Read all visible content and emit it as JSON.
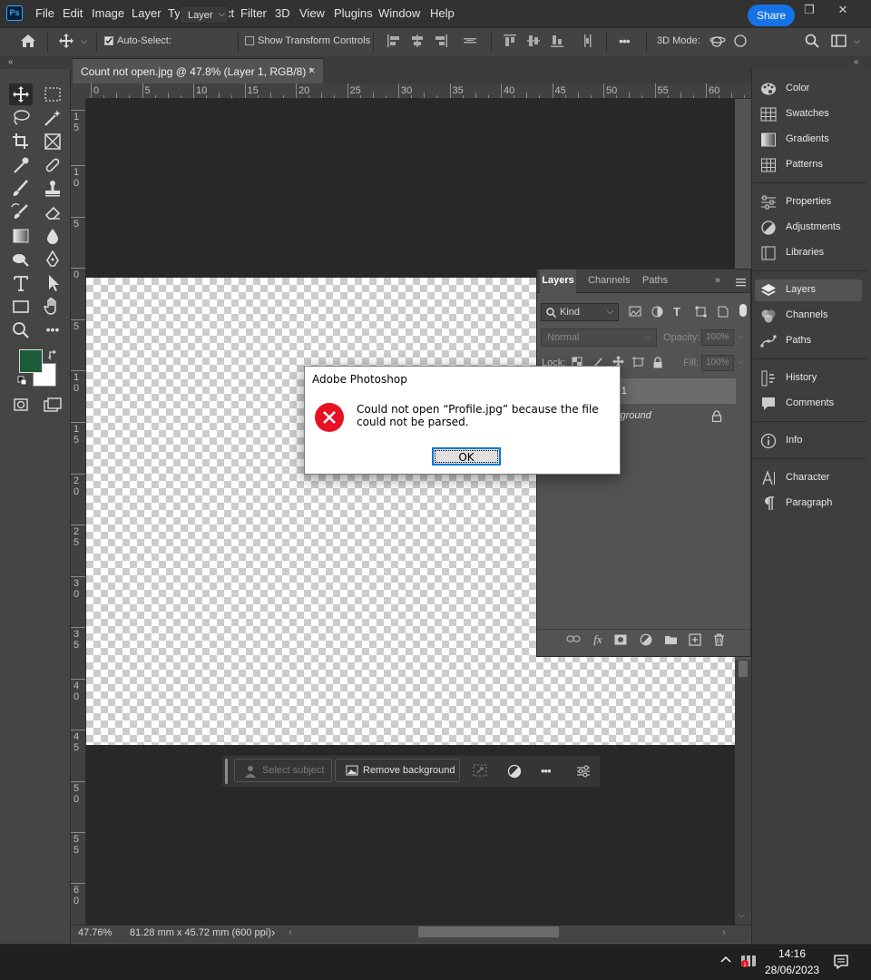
{
  "app": {
    "logo": "Ps",
    "menu": [
      "File",
      "Edit",
      "Image",
      "Layer",
      "Type",
      "Select",
      "Filter",
      "3D",
      "View",
      "Plugins",
      "Window",
      "Help"
    ],
    "window_controls": {
      "minimize": "—",
      "restore": "❐",
      "close": "✕"
    }
  },
  "options_bar": {
    "auto_select_label": "Auto-Select:",
    "auto_select_checked": true,
    "auto_select_target": "Layer",
    "show_transform_label": "Show Transform Controls",
    "show_transform_checked": false,
    "more_label": "•••",
    "mode_3d_label": "3D Mode:",
    "share_label": "Share"
  },
  "document": {
    "tab_title": "Count not open.jpg @ 47.8% (Layer 1, RGB/8) *",
    "tab_close": "×",
    "ruler_top_ticks": [
      "0",
      "5",
      "10",
      "15",
      "20",
      "25",
      "30",
      "35",
      "40",
      "45",
      "50",
      "55",
      "60"
    ],
    "ruler_left_ticks": [
      [
        "1",
        "5"
      ],
      [
        "1",
        "0"
      ],
      [
        "5"
      ],
      [
        "0"
      ],
      [
        "5"
      ],
      [
        "1",
        "0"
      ],
      [
        "1",
        "5"
      ],
      [
        "2",
        "0"
      ],
      [
        "2",
        "5"
      ],
      [
        "3",
        "0"
      ],
      [
        "3",
        "5"
      ],
      [
        "4",
        "0"
      ],
      [
        "4",
        "5"
      ],
      [
        "5",
        "0"
      ],
      [
        "5",
        "5"
      ],
      [
        "6",
        "0"
      ]
    ],
    "zoom": "47.76%",
    "doc_info": "81.28 mm x 45.72 mm (600 ppi)",
    "status_arrow": "›"
  },
  "foreground_color": "#1d5b3a",
  "background_color": "#ffffff",
  "contextual_bar": {
    "select_subject": "Select subject",
    "remove_background": "Remove background",
    "more": "•••"
  },
  "right_panel": {
    "groups": [
      [
        {
          "label": "Color",
          "icon": "color-icon"
        },
        {
          "label": "Swatches",
          "icon": "swatches-icon"
        },
        {
          "label": "Gradients",
          "icon": "gradients-icon"
        },
        {
          "label": "Patterns",
          "icon": "patterns-icon"
        }
      ],
      [
        {
          "label": "Properties",
          "icon": "properties-icon"
        },
        {
          "label": "Adjustments",
          "icon": "adjustments-icon"
        },
        {
          "label": "Libraries",
          "icon": "libraries-icon"
        }
      ],
      [
        {
          "label": "Layers",
          "icon": "layers-icon"
        },
        {
          "label": "Channels",
          "icon": "channels-icon"
        },
        {
          "label": "Paths",
          "icon": "paths-icon"
        }
      ],
      [
        {
          "label": "History",
          "icon": "history-icon"
        },
        {
          "label": "Comments",
          "icon": "comments-icon"
        }
      ],
      [
        {
          "label": "Info",
          "icon": "info-icon"
        }
      ],
      [
        {
          "label": "Character",
          "icon": "character-icon"
        },
        {
          "label": "Paragraph",
          "icon": "paragraph-icon"
        }
      ]
    ]
  },
  "layers_panel": {
    "tabs": [
      "Layers",
      "Channels",
      "Paths"
    ],
    "kind_label": "Kind",
    "blend_mode": "Normal",
    "opacity_label": "Opacity:",
    "opacity_value": "100%",
    "lock_label": "Lock:",
    "fill_label": "Fill:",
    "fill_value": "100%",
    "layers": [
      {
        "name": "r 1",
        "selected": true
      },
      {
        "name": "kground",
        "locked": true
      }
    ]
  },
  "dialog": {
    "title": "Adobe Photoshop",
    "message": "Could not open “Profile.jpg” because the file could not be parsed.",
    "ok_label": "OK"
  },
  "taskbar": {
    "chevron": "^",
    "time": "14:16",
    "date": "28/06/2023"
  }
}
